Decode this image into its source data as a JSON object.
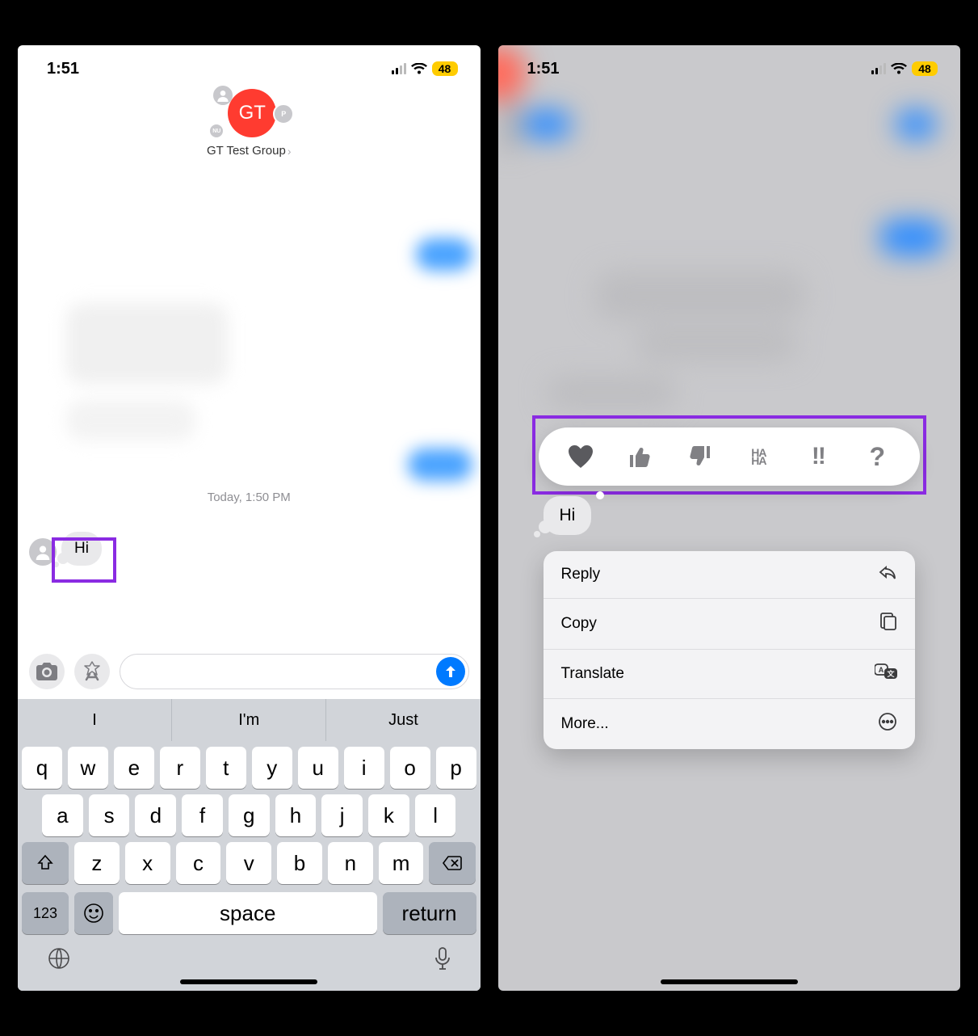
{
  "statusbar": {
    "time": "1:51",
    "battery": "48"
  },
  "header": {
    "group_initials": "GT",
    "small_p": "P",
    "small_nu": "NU",
    "title": "GT Test Group"
  },
  "conversation": {
    "timestamp": "Today, 1:50 PM",
    "message_text": "Hi"
  },
  "keyboard": {
    "suggestions": [
      "I",
      "I'm",
      "Just"
    ],
    "row1": [
      "q",
      "w",
      "e",
      "r",
      "t",
      "y",
      "u",
      "i",
      "o",
      "p"
    ],
    "row2": [
      "a",
      "s",
      "d",
      "f",
      "g",
      "h",
      "j",
      "k",
      "l"
    ],
    "row3": [
      "z",
      "x",
      "c",
      "v",
      "b",
      "n",
      "m"
    ],
    "numkey": "123",
    "space": "space",
    "return": "return"
  },
  "context_menu": {
    "items": [
      {
        "label": "Reply",
        "icon": "reply"
      },
      {
        "label": "Copy",
        "icon": "copy"
      },
      {
        "label": "Translate",
        "icon": "translate"
      },
      {
        "label": "More...",
        "icon": "more"
      }
    ]
  },
  "tapbacks": [
    "heart",
    "thumbs-up",
    "thumbs-down",
    "haha",
    "exclaim",
    "question"
  ]
}
